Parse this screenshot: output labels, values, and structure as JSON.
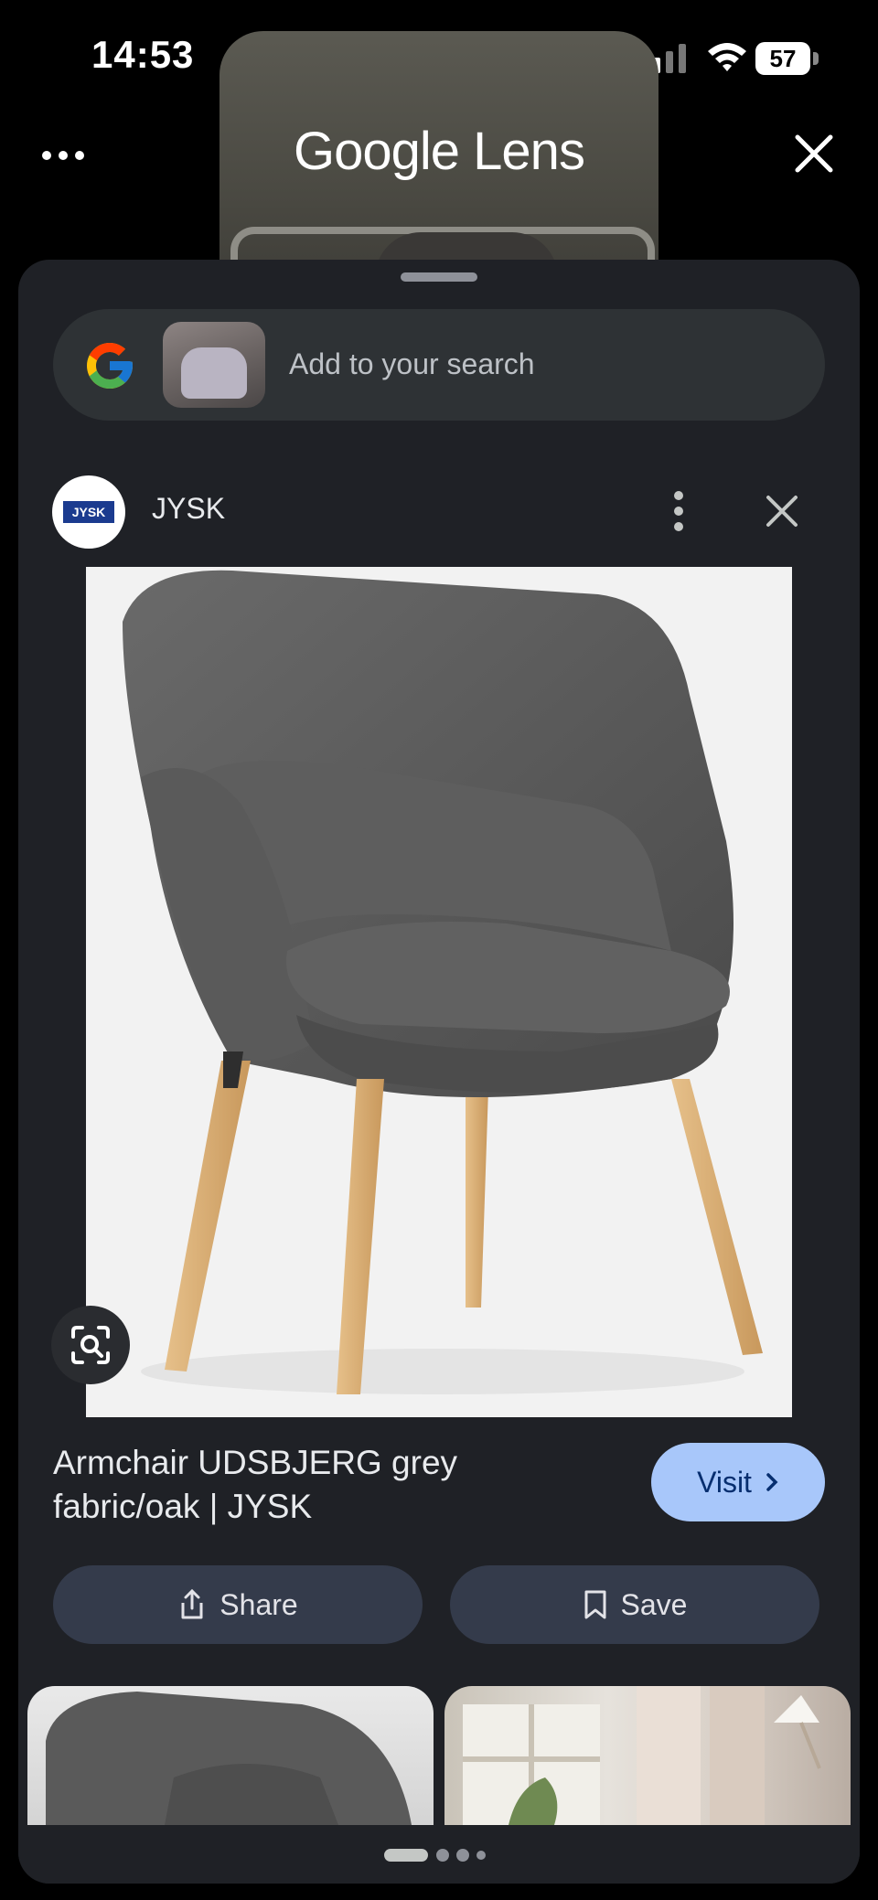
{
  "status_bar": {
    "time": "14:53",
    "battery": "57"
  },
  "header": {
    "title": "Google Lens"
  },
  "search": {
    "placeholder": "Add to your search"
  },
  "source": {
    "name": "JYSK",
    "logo_text": "JYSK"
  },
  "product": {
    "title_line1": "Armchair UDSBJERG grey",
    "title_line2": "fabric/oak | JYSK",
    "visit_label": "Visit",
    "share_label": "Share",
    "save_label": "Save"
  },
  "colors": {
    "accent": "#a8c7fa",
    "sheet": "#1f2126",
    "pill": "#343b4b"
  },
  "icons": [
    "more-icon",
    "close-icon",
    "google-g-icon",
    "kebab-icon",
    "lens-search-icon",
    "share-icon",
    "bookmark-icon",
    "chevron-right-icon"
  ]
}
